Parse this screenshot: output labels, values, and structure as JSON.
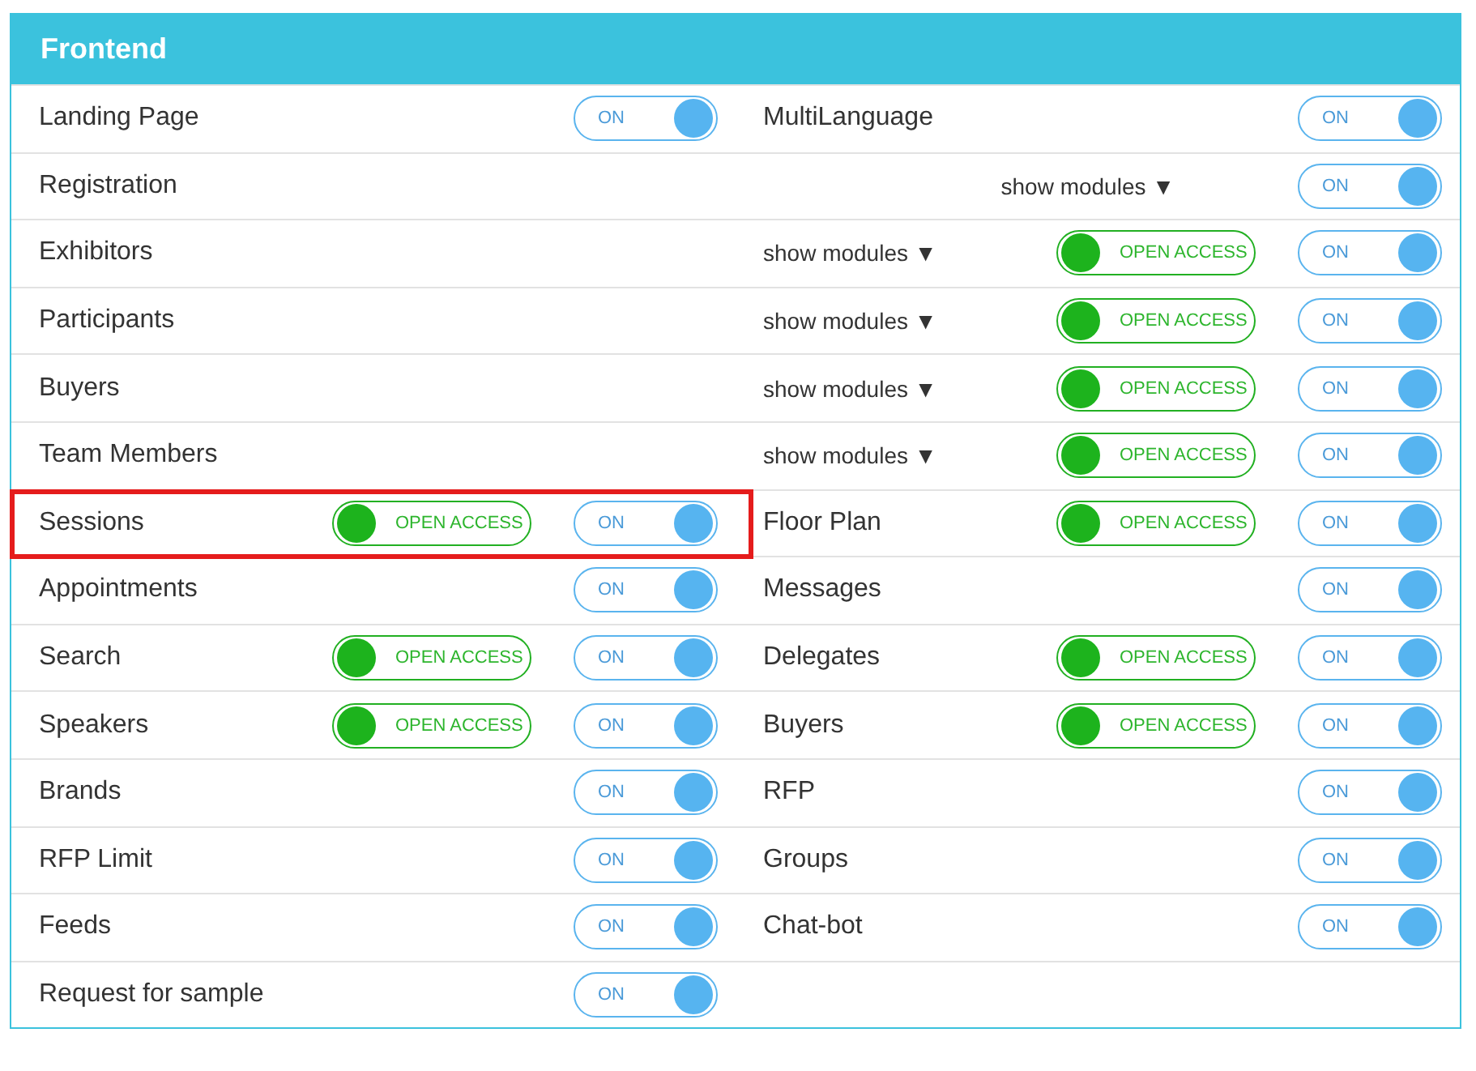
{
  "panel": {
    "title": "Frontend"
  },
  "rows": [
    {
      "cells": [
        {
          "label": "Landing Page",
          "toggle": {
            "label": "ON",
            "on": true
          }
        },
        {
          "label": "MultiLanguage",
          "toggle": {
            "label": "ON",
            "on": true
          }
        }
      ]
    },
    {
      "kind": "wide",
      "cells": [
        {
          "label": "Registration",
          "show_modules": "show modules ▼",
          "toggle": {
            "label": "ON",
            "on": true
          }
        }
      ]
    },
    {
      "kind": "wide",
      "cells": [
        {
          "label": "Exhibitors",
          "show_modules": "show modules ▼",
          "open_access": {
            "label": "OPEN ACCESS",
            "on": true
          },
          "toggle": {
            "label": "ON",
            "on": true
          }
        }
      ]
    },
    {
      "kind": "wide",
      "cells": [
        {
          "label": "Participants",
          "show_modules": "show modules ▼",
          "open_access": {
            "label": "OPEN ACCESS",
            "on": true
          },
          "toggle": {
            "label": "ON",
            "on": true
          }
        }
      ]
    },
    {
      "kind": "wide",
      "cells": [
        {
          "label": "Buyers",
          "show_modules": "show modules ▼",
          "open_access": {
            "label": "OPEN ACCESS",
            "on": true
          },
          "toggle": {
            "label": "ON",
            "on": true
          }
        }
      ]
    },
    {
      "kind": "wide",
      "cells": [
        {
          "label": "Team Members",
          "show_modules": "show modules ▼",
          "open_access": {
            "label": "OPEN ACCESS",
            "on": true
          },
          "toggle": {
            "label": "ON",
            "on": true
          }
        }
      ]
    },
    {
      "cells": [
        {
          "label": "Sessions",
          "highlighted": true,
          "open_access": {
            "label": "OPEN ACCESS",
            "on": true
          },
          "toggle": {
            "label": "ON",
            "on": true
          }
        },
        {
          "label": "Floor Plan",
          "open_access": {
            "label": "OPEN ACCESS",
            "on": true
          },
          "toggle": {
            "label": "ON",
            "on": true
          }
        }
      ]
    },
    {
      "cells": [
        {
          "label": "Appointments",
          "toggle": {
            "label": "ON",
            "on": true
          }
        },
        {
          "label": "Messages",
          "toggle": {
            "label": "ON",
            "on": true
          }
        }
      ]
    },
    {
      "cells": [
        {
          "label": "Search",
          "open_access": {
            "label": "OPEN ACCESS",
            "on": true
          },
          "toggle": {
            "label": "ON",
            "on": true
          }
        },
        {
          "label": "Delegates",
          "open_access": {
            "label": "OPEN ACCESS",
            "on": true
          },
          "toggle": {
            "label": "ON",
            "on": true
          }
        }
      ]
    },
    {
      "cells": [
        {
          "label": "Speakers",
          "open_access": {
            "label": "OPEN ACCESS",
            "on": true
          },
          "toggle": {
            "label": "ON",
            "on": true
          }
        },
        {
          "label": "Buyers",
          "open_access": {
            "label": "OPEN ACCESS",
            "on": true
          },
          "toggle": {
            "label": "ON",
            "on": true
          }
        }
      ]
    },
    {
      "cells": [
        {
          "label": "Brands",
          "toggle": {
            "label": "ON",
            "on": true
          }
        },
        {
          "label": "RFP",
          "toggle": {
            "label": "ON",
            "on": true
          }
        }
      ]
    },
    {
      "cells": [
        {
          "label": "RFP Limit",
          "toggle": {
            "label": "ON",
            "on": true
          }
        },
        {
          "label": "Groups",
          "toggle": {
            "label": "ON",
            "on": true
          }
        }
      ]
    },
    {
      "cells": [
        {
          "label": "Feeds",
          "toggle": {
            "label": "ON",
            "on": true
          }
        },
        {
          "label": "Chat-bot",
          "toggle": {
            "label": "ON",
            "on": true
          }
        }
      ]
    },
    {
      "cells": [
        {
          "label": "Request for sample",
          "toggle": {
            "label": "ON",
            "on": true
          }
        }
      ]
    }
  ]
}
